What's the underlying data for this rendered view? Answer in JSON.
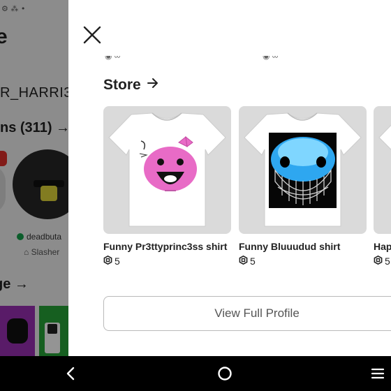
{
  "background": {
    "status_icons": "⚙ ⁂ •",
    "title_fragment": "e",
    "username_fragment": "R_HARRI3",
    "connections_fragment": "ns (311)",
    "connections_arrow": "→",
    "friend_name_fragment": "deadbuta",
    "friend_game_fragment": "Slasher",
    "section_fragment": "ge",
    "section_arrow": "→"
  },
  "panel": {
    "store": {
      "title": "Store",
      "arrow": "→",
      "items": [
        {
          "name": "Funny Pr3ttyprinc3ss shirt",
          "price": "5"
        },
        {
          "name": "Funny Bluuudud shirt",
          "price": "5"
        },
        {
          "name": "Hap",
          "price": "5"
        }
      ]
    },
    "view_profile_label": "View Full Profile"
  },
  "icons": {
    "close": "close-icon",
    "store_arrow": "arrow-right-icon",
    "currency": "robux-icon",
    "nav_back": "back-chevron-icon",
    "nav_home": "home-circle-icon",
    "nav_menu": "menu-icon"
  },
  "colors": {
    "panel_bg": "#ffffff",
    "thumb_bg": "#dadada",
    "text": "#222222",
    "button_border": "#b9b9b9",
    "nav_bg": "#000000",
    "online_dot": "#14a04a"
  }
}
